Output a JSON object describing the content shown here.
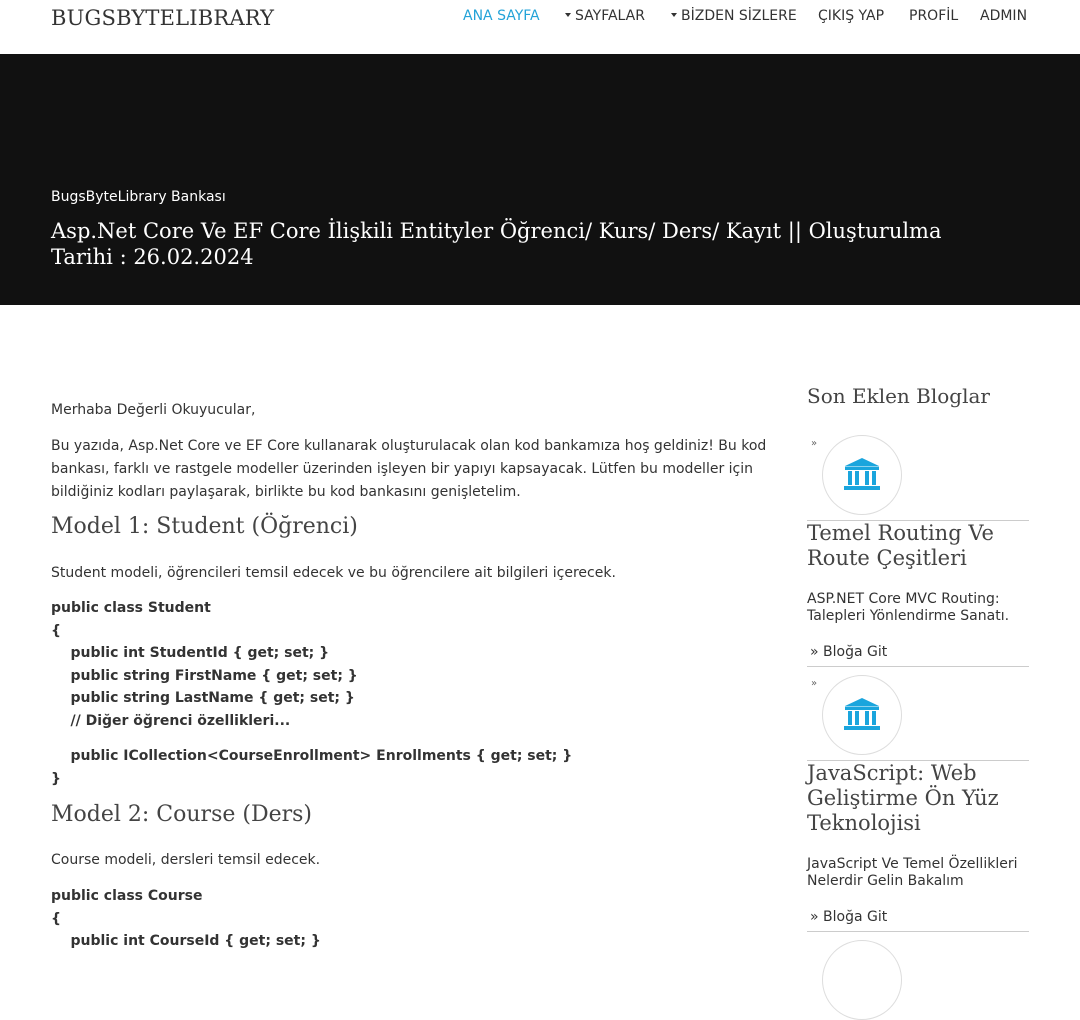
{
  "brand": "BUGSBYTELIBRARY",
  "nav": {
    "home": "ANA SAYFA",
    "pages": "SAYFALAR",
    "about": "BİZDEN SİZLERE",
    "logout": "ÇIKIŞ YAP",
    "profile": "PROFİL",
    "admin": "ADMIN"
  },
  "hero": {
    "subtitle": "BugsByteLibrary Bankası",
    "title": "Asp.Net Core Ve EF Core İlişkili Entityler Öğrenci/ Kurs/ Ders/ Kayıt || Oluşturulma Tarihi : 26.02.2024"
  },
  "article": {
    "greeting": "Merhaba Değerli Okuyucular,",
    "intro": "Bu yazıda, Asp.Net Core ve EF Core kullanarak oluşturulacak olan kod bankamıza hoş geldiniz! Bu kod bankası, farklı ve rastgele modeller üzerinden işleyen bir yapıyı kapsayacak. Lütfen bu modeller için bildiğiniz kodları paylaşarak, birlikte bu kod bankasını genişletelim.",
    "model1_heading": "Model 1: Student (Öğrenci)",
    "model1_desc": "Student modeli, öğrencileri temsil edecek ve bu öğrencilere ait bilgileri içerecek.",
    "model1_code_a": "public class Student\n{\n    public int StudentId { get; set; }\n    public string FirstName { get; set; }\n    public string LastName { get; set; }\n    // Diğer öğrenci özellikleri...",
    "model1_code_b": "    public ICollection<CourseEnrollment> Enrollments { get; set; }\n}",
    "model2_heading": "Model 2: Course (Ders)",
    "model2_desc": "Course modeli, dersleri temsil edecek.",
    "model2_code": "public class Course\n{\n    public int CourseId { get; set; }"
  },
  "sidebar": {
    "title": "Son Eklen Bloglar",
    "bullet": "»",
    "posts": [
      {
        "icon": "bank-icon",
        "title": "Temel Routing Ve Route Çeşitleri",
        "desc": "ASP.NET Core MVC Routing: Talepleri Yönlendirme Sanatı.",
        "link": "» Bloğa Git"
      },
      {
        "icon": "bank-icon",
        "title": "JavaScript: Web Geliştirme Ön Yüz Teknolojisi",
        "desc": "JavaScript Ve Temel Özellikleri Nelerdir Gelin Bakalım",
        "link": "» Bloğa Git"
      }
    ]
  },
  "colors": {
    "accent": "#23a3d8",
    "hero_bg": "#111111",
    "icon": "#1aa5dd"
  }
}
